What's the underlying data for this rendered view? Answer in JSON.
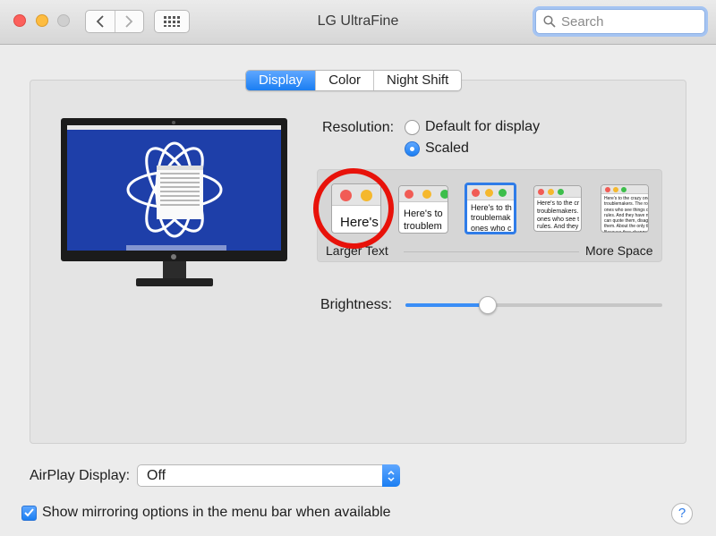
{
  "window": {
    "title": "LG UltraFine"
  },
  "toolbar": {
    "back_icon": "chevron-left-icon",
    "forward_icon": "chevron-right-icon",
    "grid_icon": "show-all-grid-icon"
  },
  "search": {
    "placeholder": "Search",
    "value": ""
  },
  "tabs": [
    {
      "label": "Display",
      "active": true
    },
    {
      "label": "Color",
      "active": false
    },
    {
      "label": "Night Shift",
      "active": false
    }
  ],
  "resolution": {
    "label": "Resolution:",
    "options": [
      {
        "label": "Default for display",
        "selected": false
      },
      {
        "label": "Scaled",
        "selected": true
      }
    ]
  },
  "scaled_options": {
    "items": [
      {
        "text": "Here's"
      },
      {
        "text": "Here's to\ntroublem"
      },
      {
        "text": "Here's to th\ntroublemak\nones who c"
      },
      {
        "text": "Here's to the cr\ntroublemakers.\nones who see t\nrules. And they"
      },
      {
        "text": "Here's to the crazy one\ntroublemakers. The rou\nones who see things di\nrules. And they have no\ncan quote them, disagre\nthem. About the only th\nBecause they change th"
      }
    ],
    "selected_index": 2,
    "left_label": "Larger Text",
    "right_label": "More Space"
  },
  "brightness": {
    "label": "Brightness:",
    "value": 0.32
  },
  "airplay": {
    "label": "AirPlay Display:",
    "selected": "Off"
  },
  "mirroring": {
    "label": "Show mirroring options in the menu bar when available",
    "checked": true
  },
  "help": {
    "label": "?"
  },
  "colors": {
    "accent": "#1a7ef2",
    "highlight_ring": "#e8120a"
  }
}
